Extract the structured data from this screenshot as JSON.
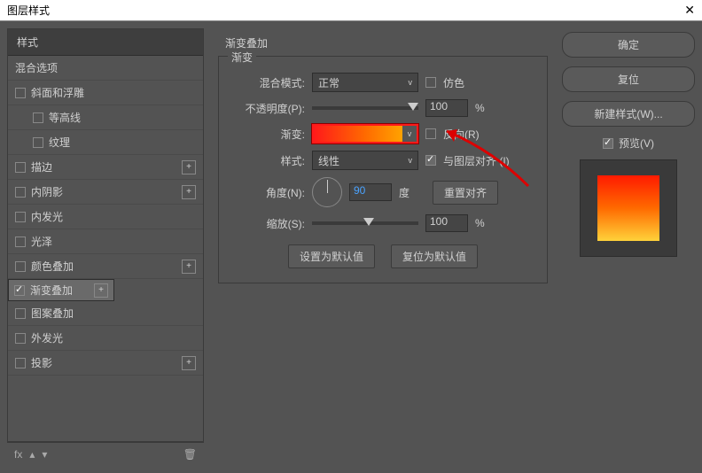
{
  "title": "图层样式",
  "sidebar": {
    "header": "样式",
    "items": [
      {
        "label": "混合选项",
        "checked": null
      },
      {
        "label": "斜面和浮雕",
        "checked": false
      },
      {
        "label": "等高线",
        "checked": false,
        "sub": true
      },
      {
        "label": "纹理",
        "checked": false,
        "sub": true
      },
      {
        "label": "描边",
        "checked": false,
        "plus": true
      },
      {
        "label": "内阴影",
        "checked": false,
        "plus": true
      },
      {
        "label": "内发光",
        "checked": false
      },
      {
        "label": "光泽",
        "checked": false
      },
      {
        "label": "颜色叠加",
        "checked": false,
        "plus": true
      },
      {
        "label": "渐变叠加",
        "checked": true,
        "plus": true,
        "selected": true
      },
      {
        "label": "图案叠加",
        "checked": false
      },
      {
        "label": "外发光",
        "checked": false
      },
      {
        "label": "投影",
        "checked": false,
        "plus": true
      }
    ],
    "footer_fx": "fx"
  },
  "panel": {
    "section_title": "渐变叠加",
    "legend": "渐变",
    "blend_label": "混合模式:",
    "blend_value": "正常",
    "dither_label": "仿色",
    "dither": false,
    "opacity_label": "不透明度(P):",
    "opacity_value": "100",
    "pct": "%",
    "grad_label": "渐变:",
    "reverse_label": "反向(R)",
    "reverse": false,
    "style_label": "样式:",
    "style_value": "线性",
    "align_label": "与图层对齐 (I)",
    "align": true,
    "angle_label": "角度(N):",
    "angle_value": "90",
    "deg": "度",
    "reset_align": "重置对齐",
    "scale_label": "缩放(S):",
    "scale_value": "100",
    "btn_default": "设置为默认值",
    "btn_reset": "复位为默认值"
  },
  "right": {
    "ok": "确定",
    "cancel": "复位",
    "new_style": "新建样式(W)...",
    "preview_label": "预览(V)",
    "preview": true
  }
}
